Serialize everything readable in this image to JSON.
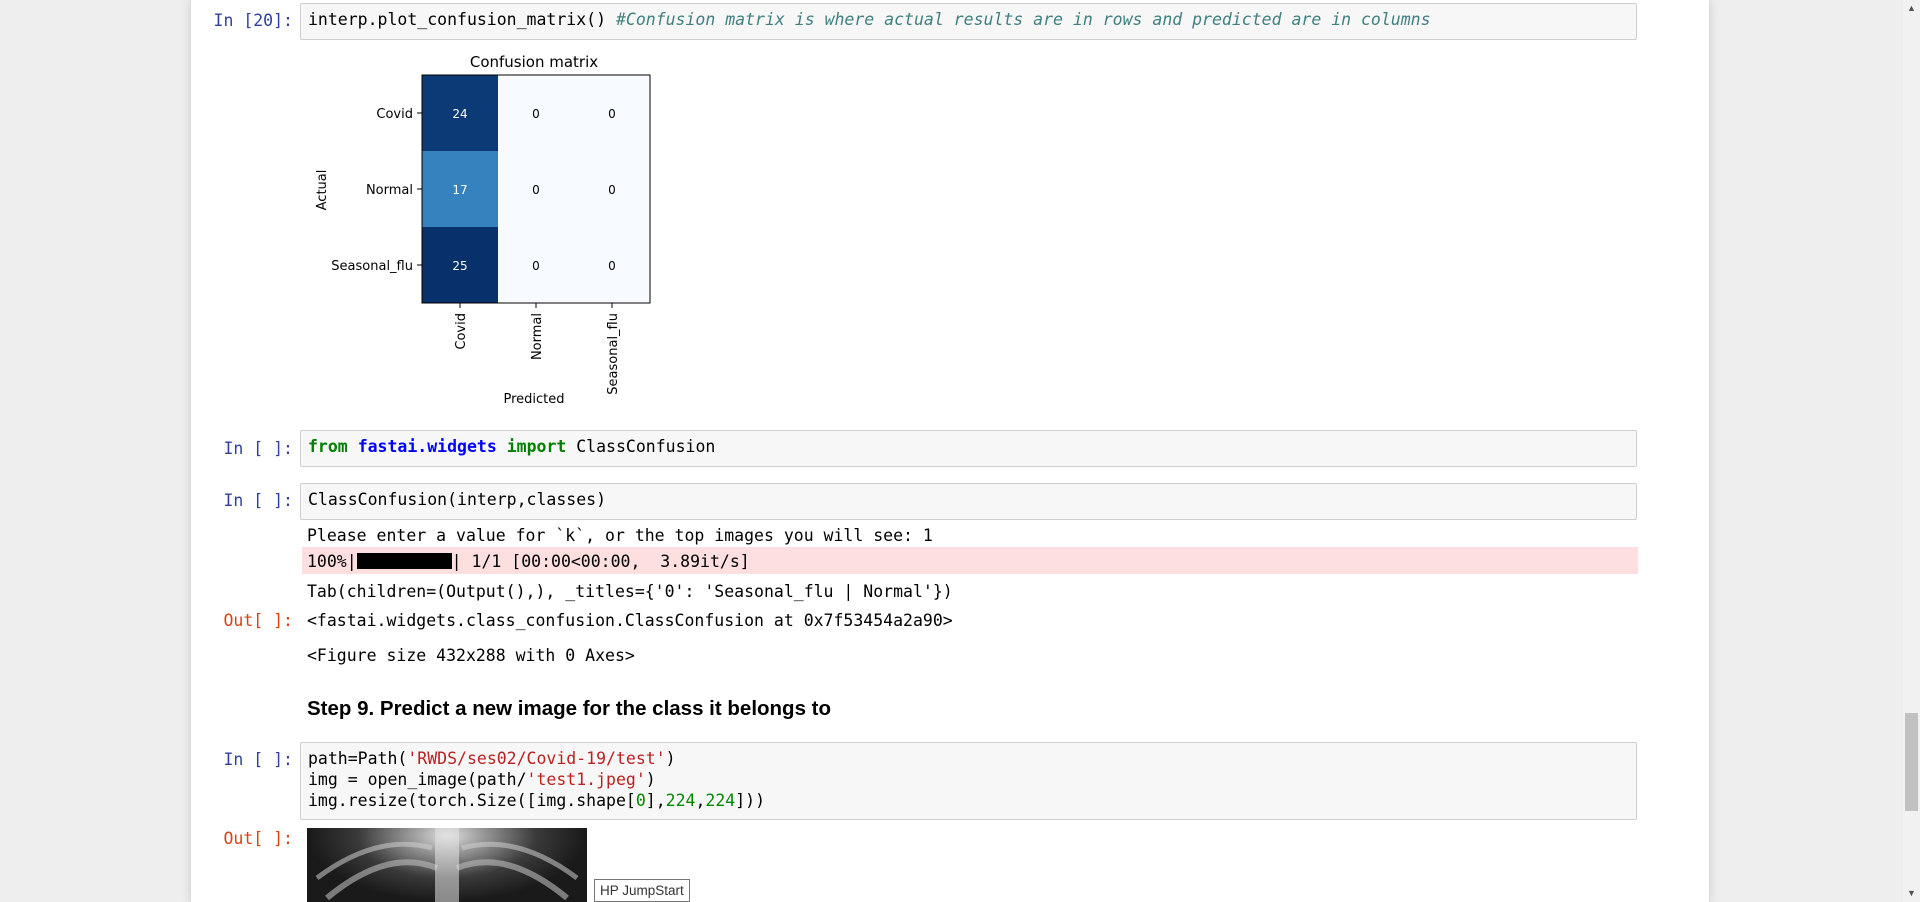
{
  "cells": {
    "c20": {
      "prompt": "In [20]:",
      "code_fn": "interp.plot_confusion_matrix()",
      "code_comment": "#Confusion matrix is where actual results are in rows and predicted are in columns"
    },
    "c_import": {
      "prompt": "In [ ]:",
      "kw_from": "from",
      "module": "fastai.widgets",
      "kw_import": "import",
      "name": "ClassConfusion"
    },
    "c_classconf": {
      "prompt": "In [ ]:",
      "code": "ClassConfusion(interp,classes)",
      "stdout_line": "Please enter a value for `k`, or the top images you will see: 1",
      "progress_prefix": "100%|",
      "progress_value": 1.0,
      "progress_suffix": "| 1/1 [00:00<00:00,  3.89it/s]",
      "tab_line": "Tab(children=(Output(),), _titles={'0': 'Seasonal_flu | Normal'})",
      "out_prompt": "Out[ ]:",
      "out_repr": "<fastai.widgets.class_confusion.ClassConfusion at 0x7f53454a2a90>",
      "figure_line": "<Figure size 432x288 with 0 Axes>"
    },
    "heading": "Step 9. Predict a new image for the class it belongs to",
    "c_predict": {
      "prompt": "In [ ]:",
      "line1_a": "path=Path(",
      "line1_str": "'RWDS/ses02/Covid-19/test'",
      "line1_b": ")",
      "line2_a": "img = open_image(path/",
      "line2_str": "'test1.jpeg'",
      "line2_b": ")",
      "line3_a": "img.resize(torch.Size([img.shape[",
      "line3_n0": "0",
      "line3_b": "],",
      "line3_n1": "224",
      "line3_c": ",",
      "line3_n2": "224",
      "line3_d": "]))",
      "out_prompt": "Out[ ]:"
    }
  },
  "tooltip": "HP JumpStart",
  "chart_data": {
    "type": "heatmap",
    "title": "Confusion matrix",
    "xlabel": "Predicted",
    "ylabel": "Actual",
    "rows": [
      "Covid",
      "Normal",
      "Seasonal_flu"
    ],
    "cols": [
      "Covid",
      "Normal",
      "Seasonal_flu"
    ],
    "values": [
      [
        24,
        0,
        0
      ],
      [
        17,
        0,
        0
      ],
      [
        25,
        0,
        0
      ]
    ],
    "colormap": "Blues"
  },
  "colors": {
    "prompt_in": "#303f9f",
    "prompt_out": "#d84315",
    "stderr_bg": "#fddfdf"
  }
}
